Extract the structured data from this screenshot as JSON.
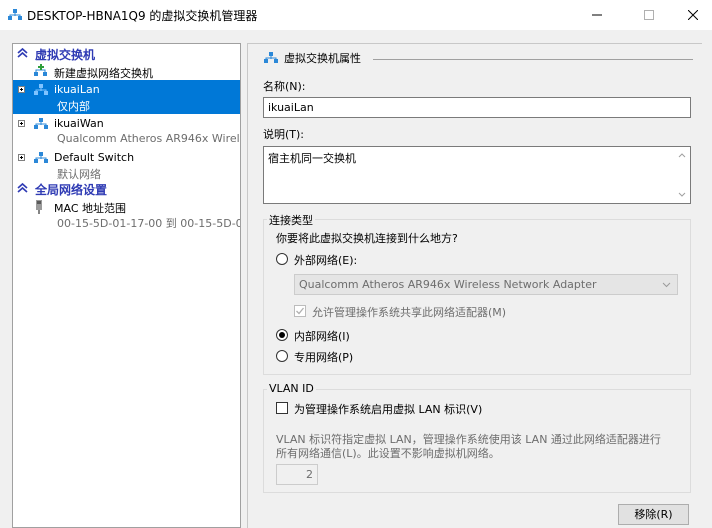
{
  "window": {
    "title": "DESKTOP-HBNA1Q9 的虚拟交换机管理器",
    "minimize": "—",
    "maximize": "☐",
    "close": "✕"
  },
  "sidebar": {
    "section_switches": "虚拟交换机",
    "new_switch": "新建虚拟网络交换机",
    "switches": [
      {
        "name": "ikuaiLan",
        "sub": "仅内部",
        "selected": true
      },
      {
        "name": "ikuaiWan",
        "sub": "Qualcomm Atheros AR946x Wirele...",
        "selected": false
      },
      {
        "name": "Default Switch",
        "sub": "默认网络",
        "selected": false
      }
    ],
    "section_global": "全局网络设置",
    "mac": {
      "name": "MAC 地址范围",
      "sub": "00-15-5D-01-17-00 到 00-15-5D-0..."
    }
  },
  "properties": {
    "title": "虚拟交换机属性",
    "name_label": "名称(N):",
    "name_value": "ikuaiLan",
    "desc_label": "说明(T):",
    "desc_value": "宿主机同一交换机",
    "conn_group": "连接类型",
    "conn_question": "你要将此虚拟交换机连接到什么地方?",
    "external_label": "外部网络(E):",
    "adapter_value": "Qualcomm Atheros AR946x Wireless Network Adapter",
    "allow_mgmt_label": "允许管理操作系统共享此网络适配器(M)",
    "internal_label": "内部网络(I)",
    "private_label": "专用网络(P)",
    "vlan_group": "VLAN ID",
    "vlan_enable_label": "为管理操作系统启用虚拟 LAN 标识(V)",
    "vlan_desc_1": "VLAN 标识符指定虚拟 LAN，管理操作系统使用该 LAN 通过此网络适配器进行",
    "vlan_desc_2": "所有网络通信(L)。此设置不影响虚拟机网络。",
    "vlan_value": "2",
    "remove_button": "移除(R)"
  },
  "colors": {
    "selection": "#0078d7",
    "section_header": "#2f3bb4",
    "window_bg": "#f0f0f0"
  },
  "icons": {
    "app": "hyper-v-switch-icon",
    "new_switch": "add-network-icon",
    "switch": "network-switch-icon",
    "mac": "network-adapter-icon",
    "collapse": "double-chevron-up-icon"
  }
}
